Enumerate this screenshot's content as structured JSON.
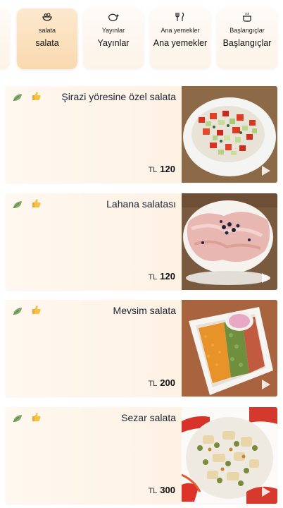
{
  "categories": [
    {
      "id": "prev",
      "small": "",
      "big": "",
      "icon": "partial"
    },
    {
      "id": "salata",
      "small": "salata",
      "big": "salata",
      "icon": "bowl-icon",
      "active": true
    },
    {
      "id": "yayinlar",
      "small": "Yayınlar",
      "big": "Yayınlar",
      "icon": "chicken-icon"
    },
    {
      "id": "ana",
      "small": "Ana yemekler",
      "big": "Ana yemekler",
      "icon": "utensils-icon"
    },
    {
      "id": "baslangic",
      "small": "Başlangıçlar",
      "big": "Başlangıçlar",
      "icon": "pot-icon"
    }
  ],
  "items": [
    {
      "name": "Şirazi yöresine özel salata",
      "currency": "TL",
      "price": "120"
    },
    {
      "name": "Lahana salatası",
      "currency": "TL",
      "price": "120"
    },
    {
      "name": "Mevsim salata",
      "currency": "TL",
      "price": "200"
    },
    {
      "name": "Sezar salata",
      "currency": "TL",
      "price": "300"
    }
  ],
  "colors": {
    "active_tab": "#f9d9af",
    "card_bg": "#fdeedd"
  }
}
